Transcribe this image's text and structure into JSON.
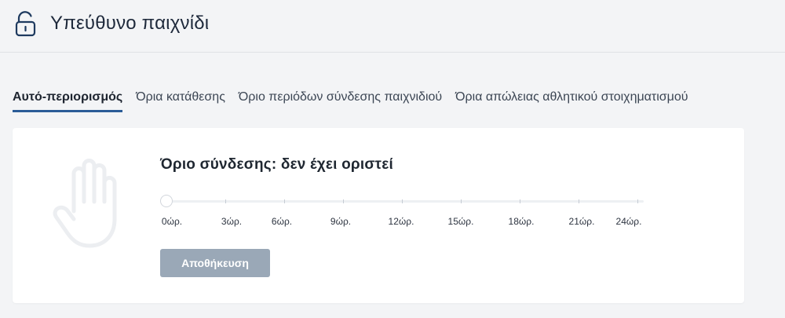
{
  "header": {
    "title": "Υπεύθυνο παιχνίδι",
    "icon": "unlocked-padlock-icon"
  },
  "tabs": [
    {
      "label": "Αυτό-περιορισμός",
      "active": true
    },
    {
      "label": "Όρια κατάθεσης",
      "active": false
    },
    {
      "label": "Όριο περιόδων σύνδεσης παιχνιδιού",
      "active": false
    },
    {
      "label": "Όρια απώλειας αθλητικού στοιχηματισμού",
      "active": false
    }
  ],
  "card": {
    "icon": "raised-hand-icon",
    "limit_title": "Όριο σύνδεσης: δεν έχει οριστεί",
    "slider": {
      "value": 0,
      "min": 0,
      "max": 24,
      "tick_labels": [
        "0ώρ.",
        "3ώρ.",
        "6ώρ.",
        "9ώρ.",
        "12ώρ.",
        "15ώρ.",
        "18ώρ.",
        "21ώρ.",
        "24ώρ."
      ]
    },
    "save_label": "Αποθήκευση"
  },
  "colors": {
    "active_tab_underline": "#2b5c97",
    "disabled_button": "#9aa8b7",
    "page_background": "#f3f4f6"
  }
}
